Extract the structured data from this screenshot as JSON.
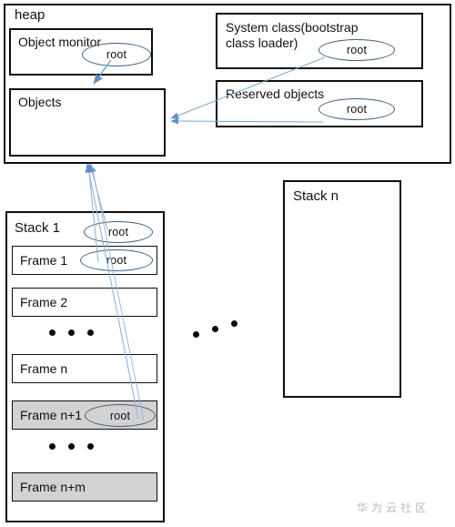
{
  "diagram": {
    "title_watermark": "华为云社区",
    "heap": {
      "label": "heap",
      "boxes": {
        "object_monitor": {
          "label": "Object monitor",
          "root_label": "root"
        },
        "objects": {
          "label": "Objects"
        },
        "system_class": {
          "label": "System class(bootstrap\nclass loader)",
          "root_label": "root"
        },
        "reserved_objects": {
          "label": "Reserved objects",
          "root_label": "root"
        }
      }
    },
    "stacks": [
      {
        "label": "Stack 1",
        "root_label": "root",
        "frames": [
          {
            "label": "Frame 1",
            "root_label": "root",
            "highlighted": false
          },
          {
            "label": "Frame 2",
            "root_label": "",
            "highlighted": false
          },
          {
            "label": "Frame n",
            "root_label": "",
            "highlighted": false
          },
          {
            "label": "Frame n+1",
            "root_label": "root",
            "highlighted": true
          },
          {
            "label": "Frame n+m",
            "root_label": "",
            "highlighted": true
          }
        ],
        "ellipsis": [
          "• • •",
          "• • •"
        ]
      },
      {
        "label": "Stack n",
        "root_label": "",
        "frames": [],
        "ellipsis": []
      }
    ],
    "between_stacks_dots": "• • •",
    "colors": {
      "border": "#0d0d0d",
      "highlight_fill": "#d2d2d2",
      "arrow": "#5b8fc9",
      "ellipse_stroke": "#3d6080",
      "text": "#111111",
      "watermark": "#b9b9b9"
    }
  }
}
